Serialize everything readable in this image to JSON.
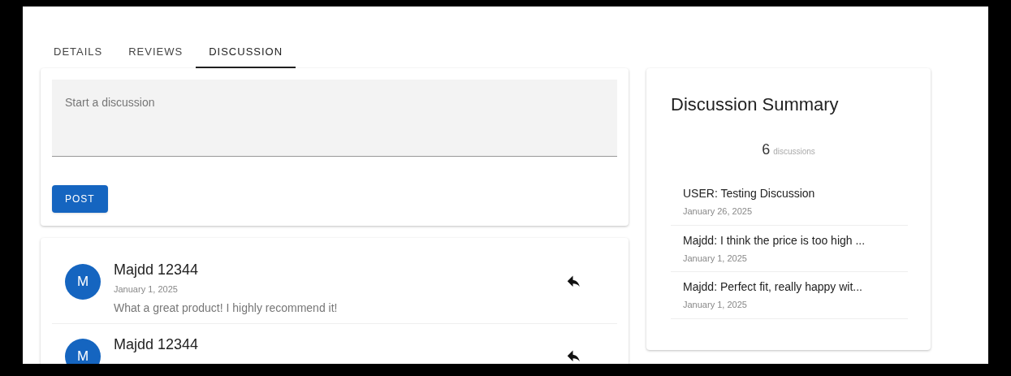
{
  "tabs": [
    {
      "label": "DETAILS",
      "selected": false
    },
    {
      "label": "REVIEWS",
      "selected": false
    },
    {
      "label": "DISCUSSION",
      "selected": true
    }
  ],
  "composer": {
    "placeholder": "Start a discussion",
    "button": "POST"
  },
  "discussions": [
    {
      "avatar": "M",
      "name": "Majdd 12344",
      "date": "January 1, 2025",
      "message": "What a great product! I highly recommend it!"
    },
    {
      "avatar": "M",
      "name": "Majdd 12344"
    }
  ],
  "summary": {
    "title": "Discussion Summary",
    "count": "6",
    "count_label": "discussions",
    "items": [
      {
        "title": "USER: Testing Discussion",
        "date": "January 26, 2025"
      },
      {
        "title": "Majdd: I think the price is too high ...",
        "date": "January 1, 2025"
      },
      {
        "title": "Majdd: Perfect fit, really happy wit...",
        "date": "January 1, 2025"
      }
    ]
  }
}
